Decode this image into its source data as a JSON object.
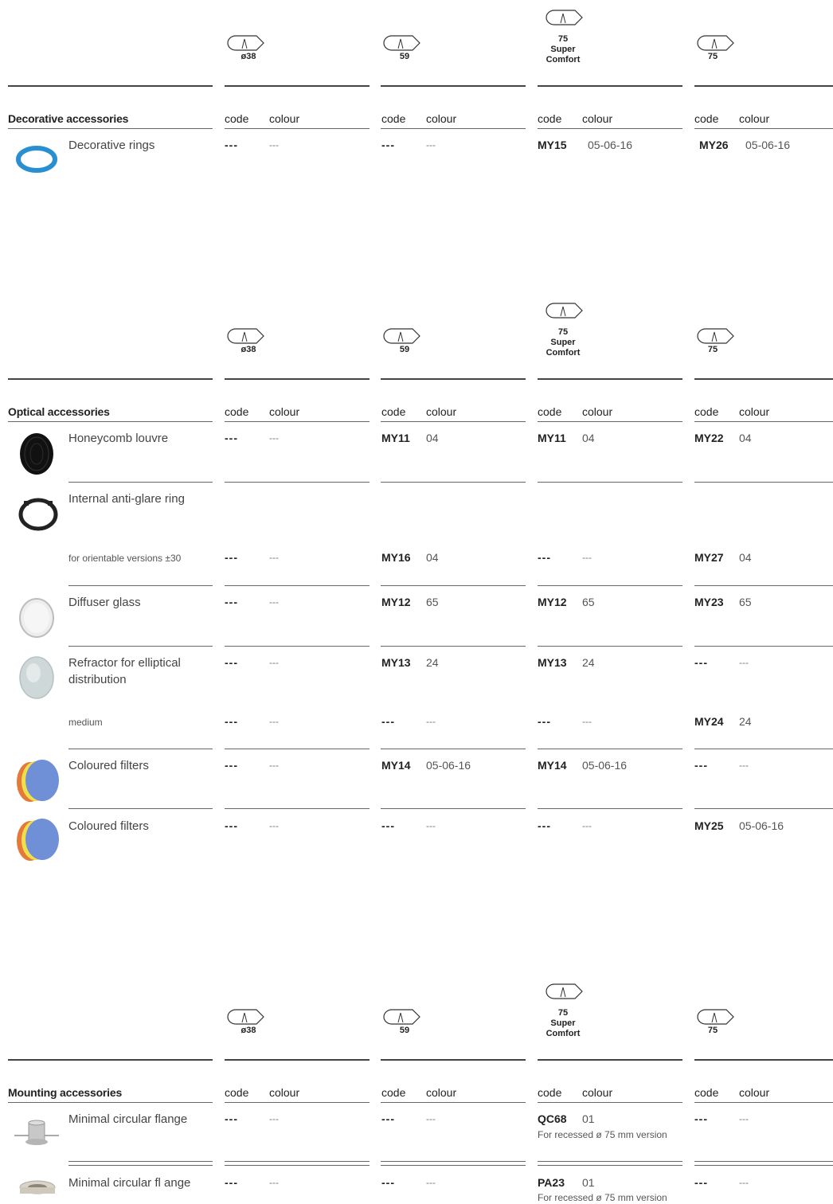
{
  "column_headers": [
    "ø38",
    "59",
    "75 Super Comfort",
    "75"
  ],
  "col_code": "code",
  "col_colour": "colour",
  "dash": "---",
  "sections": [
    {
      "title": "Decorative accessories",
      "rows": [
        {
          "name": "Decorative rings",
          "cells": [
            [
              "---",
              "---"
            ],
            [
              "---",
              "---"
            ],
            [
              "MY15",
              "05-06-16"
            ],
            [
              "MY26",
              "05-06-16"
            ]
          ]
        }
      ]
    },
    {
      "title": "Optical accessories",
      "rows": [
        {
          "name": "Honeycomb louvre",
          "cells": [
            [
              "---",
              "---"
            ],
            [
              "MY11",
              "04"
            ],
            [
              "MY11",
              "04"
            ],
            [
              "MY22",
              "04"
            ]
          ]
        },
        {
          "name": "Internal anti-glare ring"
        },
        {
          "name": "for orientable versions ±30",
          "cells": [
            [
              "---",
              "---"
            ],
            [
              "MY16",
              "04"
            ],
            [
              "---",
              "---"
            ],
            [
              "MY27",
              "04"
            ]
          ]
        },
        {
          "name": "Diffuser glass",
          "cells": [
            [
              "---",
              "---"
            ],
            [
              "MY12",
              "65"
            ],
            [
              "MY12",
              "65"
            ],
            [
              "MY23",
              "65"
            ]
          ]
        },
        {
          "name": "Refractor for elliptical distribution",
          "cells": [
            [
              "---",
              "---"
            ],
            [
              "MY13",
              "24"
            ],
            [
              "MY13",
              "24"
            ],
            [
              "---",
              "---"
            ]
          ]
        },
        {
          "name": "medium",
          "cells": [
            [
              "---",
              "---"
            ],
            [
              "---",
              "---"
            ],
            [
              "---",
              "---"
            ],
            [
              "MY24",
              "24"
            ]
          ]
        },
        {
          "name": "Coloured filters",
          "cells": [
            [
              "---",
              "---"
            ],
            [
              "MY14",
              "05-06-16"
            ],
            [
              "MY14",
              "05-06-16"
            ],
            [
              "---",
              "---"
            ]
          ]
        },
        {
          "name": "Coloured filters",
          "cells": [
            [
              "---",
              "---"
            ],
            [
              "---",
              "---"
            ],
            [
              "---",
              "---"
            ],
            [
              "MY25",
              "05-06-16"
            ]
          ]
        }
      ]
    },
    {
      "title": "Mounting accessories",
      "rows": [
        {
          "name": "Minimal circular flange",
          "cells": [
            [
              "---",
              "---"
            ],
            [
              "---",
              "---"
            ],
            [
              "QC68",
              "01"
            ],
            [
              "---",
              "---"
            ]
          ],
          "note": "For recessed ø 75 mm version"
        },
        {
          "name": "Minimal circular fl ange",
          "cells": [
            [
              "---",
              "---"
            ],
            [
              "---",
              "---"
            ],
            [
              "PA23",
              "01"
            ],
            [
              "---",
              "---"
            ]
          ],
          "note": "For recessed ø 75 mm version"
        }
      ]
    }
  ],
  "icons": {
    "beam": "light-beam-icon",
    "ring": "decorative-ring-icon",
    "louvre": "honeycomb-louvre-icon",
    "antiglare": "anti-glare-ring-icon",
    "diffuser": "diffuser-glass-icon",
    "refractor": "refractor-icon",
    "filters": "coloured-filters-icon",
    "flange": "circular-flange-icon"
  },
  "colors": {
    "text": "#333333",
    "rule": "#444444",
    "ring_blue": "#2a8fd0"
  }
}
